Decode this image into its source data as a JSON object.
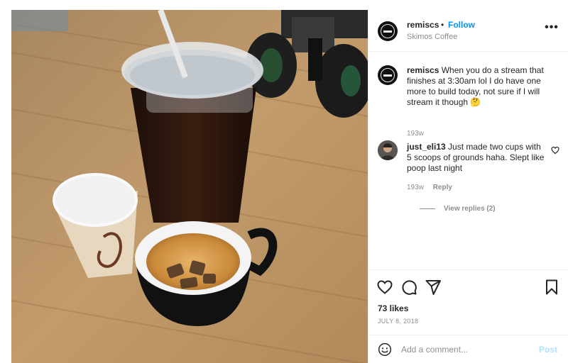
{
  "post": {
    "username": "remiscs",
    "separator": "•",
    "follow_label": "Follow",
    "location": "Skimos Coffee",
    "more_icon": "more-options-icon",
    "more_label": "•••"
  },
  "caption": {
    "username": "remiscs",
    "text": "When you do a stream that finishes at 3:30am lol I do have one more to build today, not sure if I will stream it though 🤔",
    "age": "193w"
  },
  "comments": [
    {
      "username": "just_eli13",
      "text": "Just made two cups with 5 scoops of grounds haha. Slept like poop last night",
      "age": "193w",
      "reply_label": "Reply",
      "view_replies_label": "View replies (2)"
    }
  ],
  "actions": {
    "icons": [
      "heart-icon",
      "comment-icon",
      "share-icon",
      "bookmark-icon"
    ],
    "likes_label": "73 likes",
    "date_label": "JULY 8, 2018"
  },
  "composer": {
    "placeholder": "Add a comment...",
    "post_label": "Post",
    "emoji_icon": "emoji-icon"
  },
  "colors": {
    "link": "#0095f6",
    "post_disabled": "#b2dffc",
    "secondary_text": "#8e8e8e",
    "divider": "#efefef"
  }
}
